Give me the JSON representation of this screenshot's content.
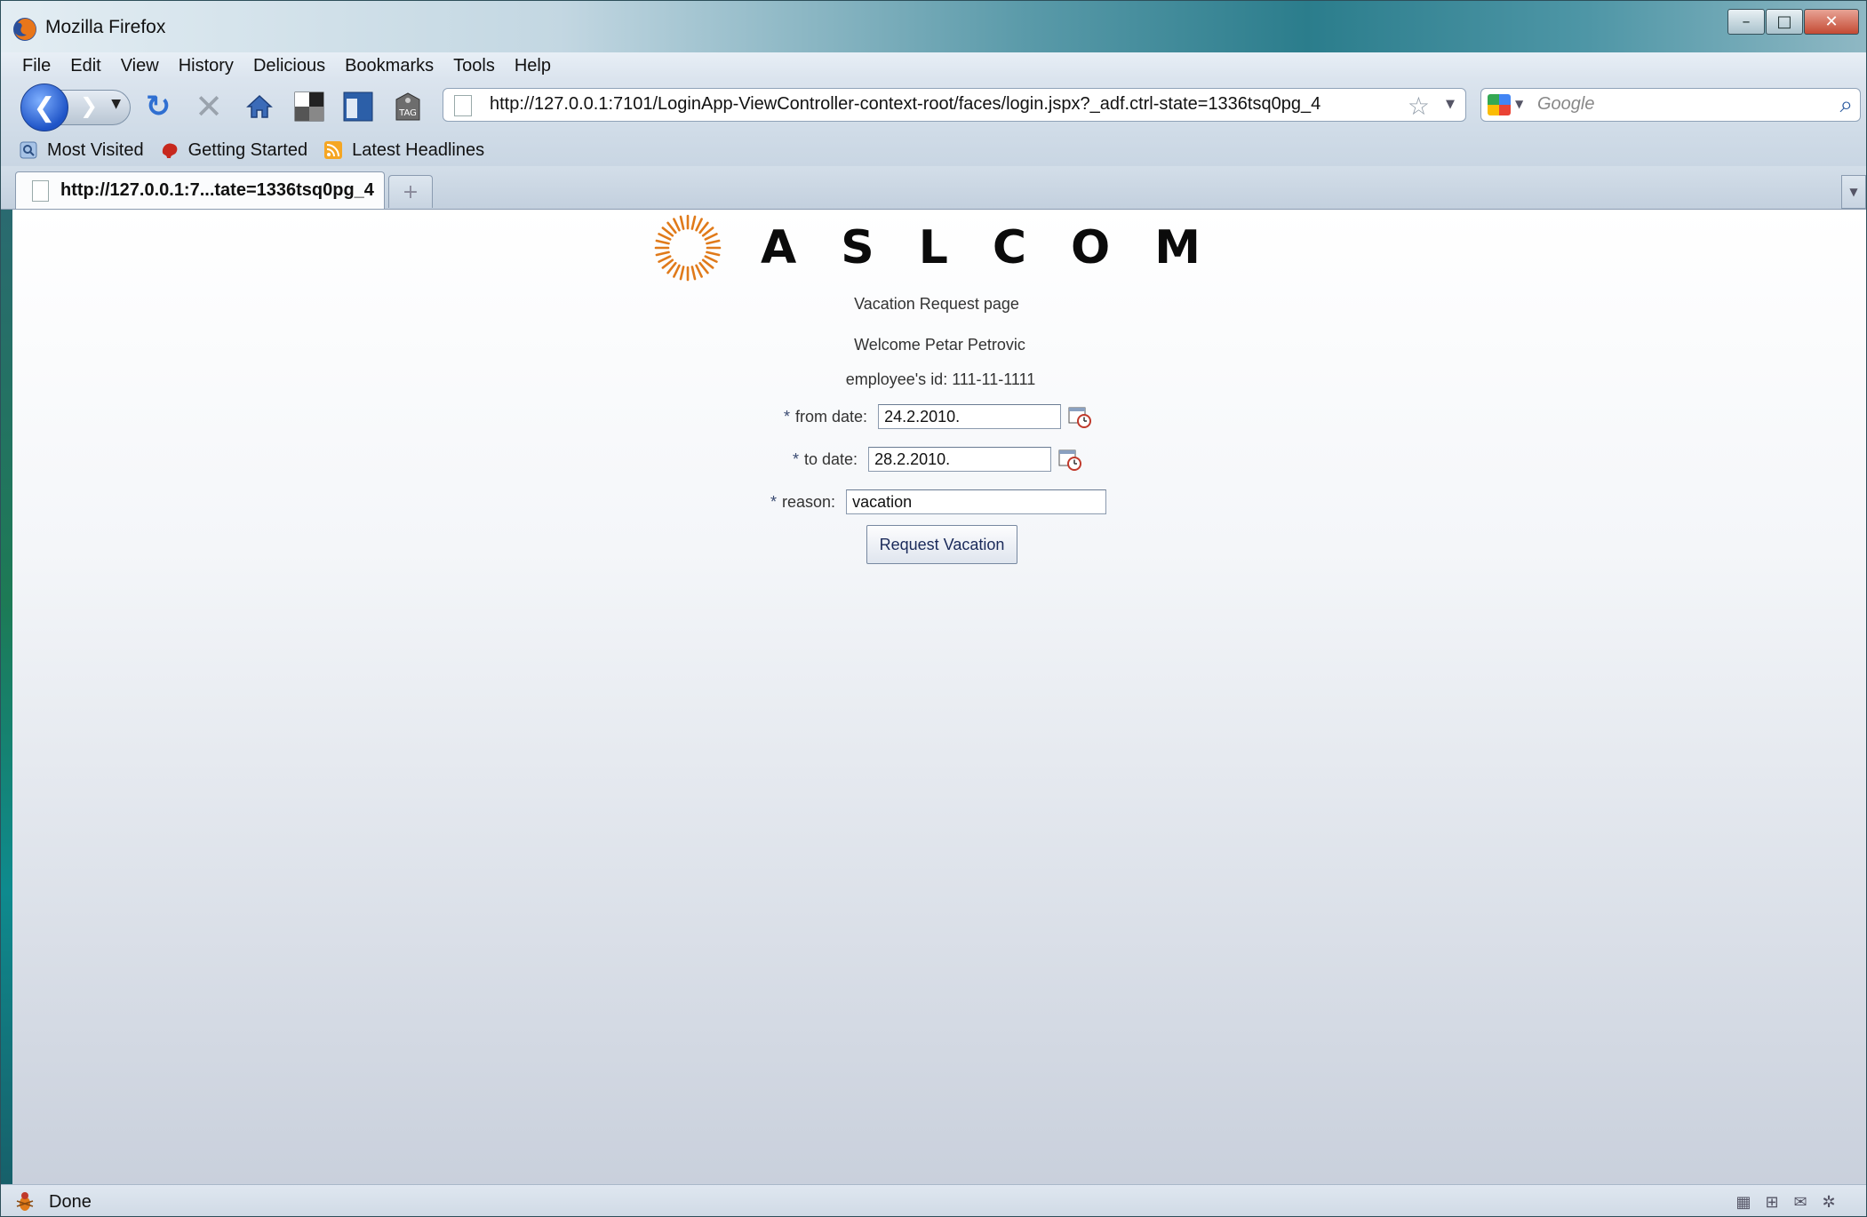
{
  "window": {
    "title": "Mozilla Firefox",
    "controls": {
      "minimize": "–",
      "maximize": "□",
      "close": "✕"
    }
  },
  "menubar": {
    "items": [
      {
        "label": "File"
      },
      {
        "label": "Edit"
      },
      {
        "label": "View"
      },
      {
        "label": "History"
      },
      {
        "label": "Delicious"
      },
      {
        "label": "Bookmarks"
      },
      {
        "label": "Tools"
      },
      {
        "label": "Help"
      }
    ]
  },
  "toolbar": {
    "back_glyph": "❮",
    "forward_glyph": "❯",
    "reload_glyph": "↻",
    "stop_glyph": "✕",
    "tag_label": "TAG",
    "url": "http://127.0.0.1:7101/LoginApp-ViewController-context-root/faces/login.jspx?_adf.ctrl-state=1336tsq0pg_4",
    "star_glyph": "☆",
    "search_placeholder": "Google"
  },
  "bookmarks": {
    "items": [
      {
        "label": "Most Visited",
        "icon": "most-visited-icon"
      },
      {
        "label": "Getting Started",
        "icon": "getting-started-icon"
      },
      {
        "label": "Latest Headlines",
        "icon": "rss-feed-icon"
      }
    ]
  },
  "tabs": [
    {
      "title": "http://127.0.0.1:7...tate=1336tsq0pg_4",
      "active": true
    }
  ],
  "page": {
    "brand": "ASLCOM",
    "title": "Vacation Request page",
    "welcome": "Welcome  Petar Petrovic",
    "employee_id": "employee's id:  111-11-1111",
    "fields": {
      "from_date": {
        "label": "from date:",
        "value": "24.2.2010.",
        "required": "*"
      },
      "to_date": {
        "label": "to date:",
        "value": "28.2.2010.",
        "required": "*"
      },
      "reason": {
        "label": "reason:",
        "value": "vacation",
        "required": "*"
      }
    },
    "submit_label": "Request Vacation"
  },
  "status": {
    "text": "Done"
  },
  "colors": {
    "brand_orange": "#e07a1a",
    "accent_blue": "#1f54c7"
  }
}
